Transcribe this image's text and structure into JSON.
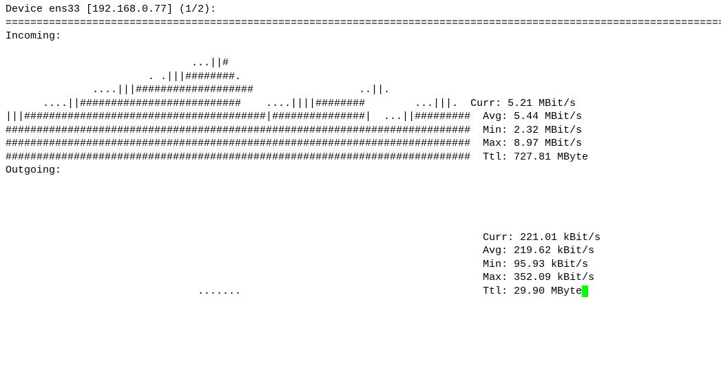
{
  "header": {
    "device_line": "Device ens33 [192.168.0.77] (1/2):",
    "divider": "=============================================================================================================================="
  },
  "incoming": {
    "label": "Incoming:",
    "graph_lines": [
      "                              ...||#",
      "                       . .|||########.",
      "              ....|||###################                 ..||.",
      "      ....||##########################    ....||||########        ...|||.",
      "|||#######################################|###############|  ...||#########",
      "###########################################################################",
      "###########################################################################",
      "###########################################################################"
    ],
    "stats": {
      "curr": "Curr: 5.21 MBit/s",
      "avg": "Avg: 5.44 MBit/s",
      "min": "Min: 2.32 MBit/s",
      "max": "Max: 8.97 MBit/s",
      "ttl": "Ttl: 727.81 MByte"
    }
  },
  "outgoing": {
    "label": "Outgoing:",
    "graph_lines": [
      "                                                                          ",
      "                                                                          ",
      "                                                                          ",
      "                                                                          ",
      "                                                                          ",
      "                                                                          ",
      "                                                                          ",
      "                               .......                                    "
    ],
    "stats": {
      "curr": "Curr: 221.01 kBit/s",
      "avg": "Avg: 219.62 kBit/s",
      "min": "Min: 95.93 kBit/s",
      "max": "Max: 352.09 kBit/s",
      "ttl": "Ttl: 29.90 MByte"
    }
  }
}
